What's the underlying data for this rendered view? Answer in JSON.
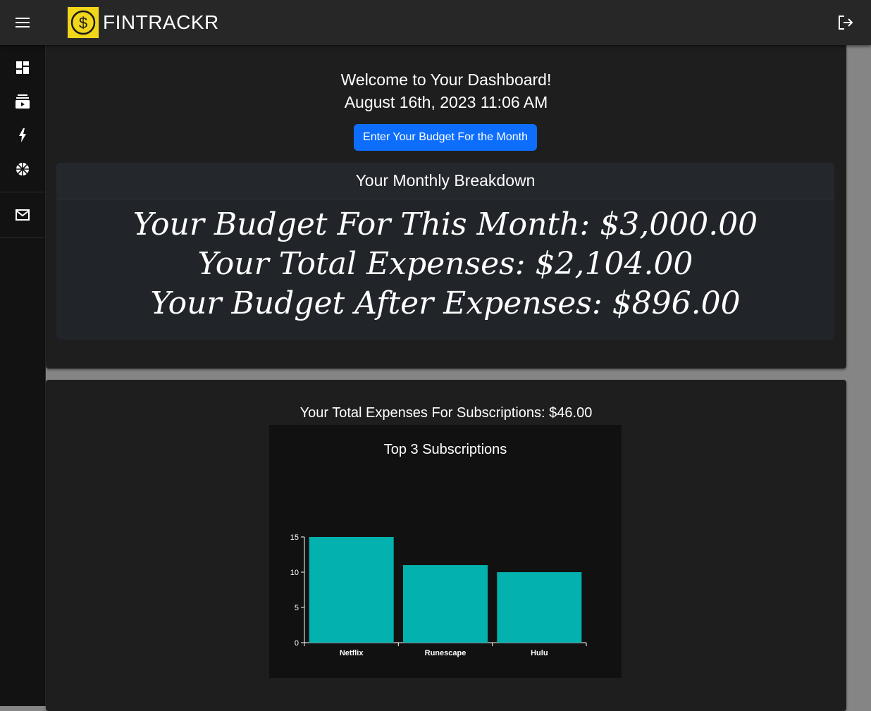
{
  "app": {
    "name": "FINTRACKR",
    "logo_symbol": "$",
    "brand_color": "#f2d61a"
  },
  "header": {
    "menu_icon": "hamburger-icon",
    "logout_icon": "logout-icon"
  },
  "sidebar": {
    "items": [
      {
        "icon": "dashboard-icon"
      },
      {
        "icon": "subscriptions-icon"
      },
      {
        "icon": "bolt-icon"
      },
      {
        "icon": "basketball-icon"
      },
      {
        "icon": "mail-icon"
      }
    ]
  },
  "dashboard": {
    "welcome": "Welcome to Your Dashboard!",
    "datetime": "August 16th, 2023 11:06 AM",
    "budget_button": "Enter Your Budget For the Month",
    "accent_color": "#0d6efd",
    "breakdown_title": "Your Monthly Breakdown",
    "budget_line": "Your Budget For This Month: $3,000.00",
    "expenses_line": "Your Total Expenses: $2,104.00",
    "after_line": "Your Budget After Expenses: $896.00"
  },
  "subscriptions": {
    "total_text": "Your Total Expenses For Subscriptions: $46.00"
  },
  "chart_data": {
    "type": "bar",
    "title": "Top 3 Subscriptions",
    "categories": [
      "Netflix",
      "Runescape",
      "Hulu"
    ],
    "values": [
      15,
      11,
      10
    ],
    "yticks": [
      "0",
      "5",
      "10",
      "15"
    ],
    "ylim": [
      0,
      15
    ],
    "bar_color": "#03b1af",
    "xlabel": "",
    "ylabel": ""
  }
}
